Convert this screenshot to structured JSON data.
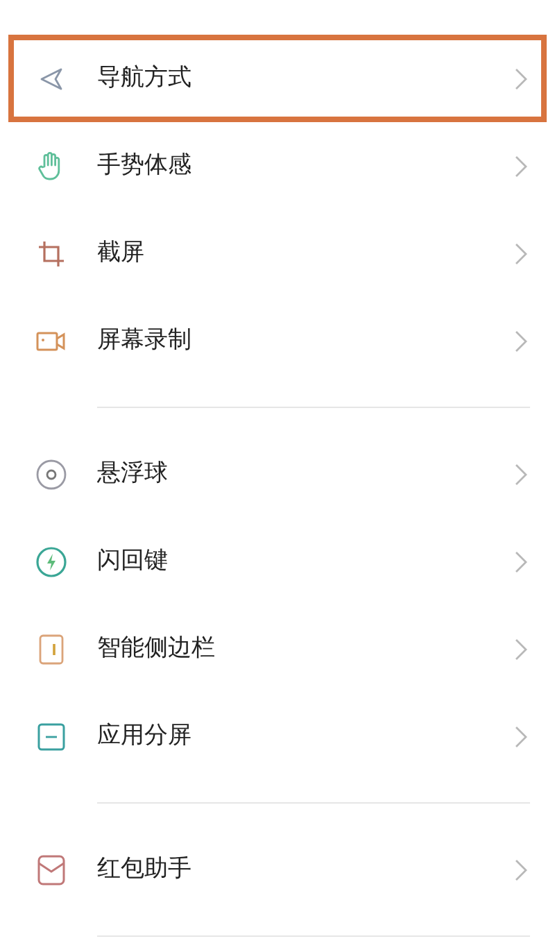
{
  "sections": [
    {
      "items": [
        {
          "label": "导航方式",
          "highlighted": true
        },
        {
          "label": "手势体感",
          "highlighted": false
        },
        {
          "label": "截屏",
          "highlighted": false
        },
        {
          "label": "屏幕录制",
          "highlighted": false
        }
      ]
    },
    {
      "items": [
        {
          "label": "悬浮球",
          "highlighted": false
        },
        {
          "label": "闪回键",
          "highlighted": false
        },
        {
          "label": "智能侧边栏",
          "highlighted": false
        },
        {
          "label": "应用分屏",
          "highlighted": false
        }
      ]
    },
    {
      "items": [
        {
          "label": "红包助手",
          "highlighted": false
        }
      ]
    }
  ]
}
